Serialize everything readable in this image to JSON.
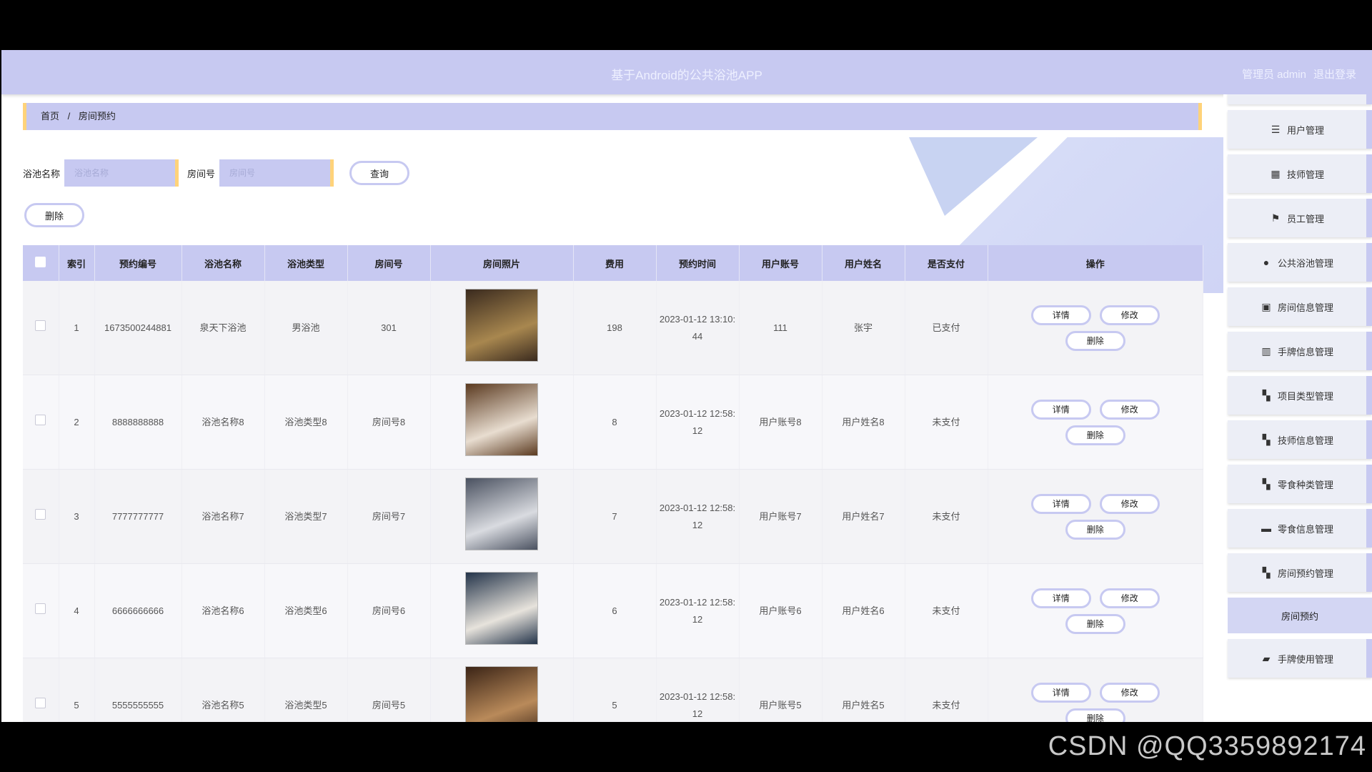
{
  "header": {
    "title": "基于Android的公共浴池APP",
    "role": "管理员 admin",
    "logout": "退出登录"
  },
  "breadcrumb": {
    "home": "首页",
    "separator": "/",
    "current": "房间预约"
  },
  "search": {
    "pool_label": "浴池名称",
    "pool_placeholder": "浴池名称",
    "room_label": "房间号",
    "room_placeholder": "房间号",
    "query_button": "查询"
  },
  "toolbar": {
    "delete_button": "删除"
  },
  "table": {
    "headers": [
      "索引",
      "预约编号",
      "浴池名称",
      "浴池类型",
      "房间号",
      "房间照片",
      "费用",
      "预约时间",
      "用户账号",
      "用户姓名",
      "是否支付",
      "操作"
    ],
    "rows": [
      {
        "index": "1",
        "code": "1673500244881",
        "pool": "泉天下浴池",
        "type": "男浴池",
        "room": "301",
        "fee": "198",
        "time": "2023-01-12 13:10:44",
        "account": "111",
        "name": "张宇",
        "paid": "已支付",
        "photo_colors": [
          "#3a2a1e",
          "#a8874f"
        ]
      },
      {
        "index": "2",
        "code": "8888888888",
        "pool": "浴池名称8",
        "type": "浴池类型8",
        "room": "房间号8",
        "fee": "8",
        "time": "2023-01-12 12:58:12",
        "account": "用户账号8",
        "name": "用户姓名8",
        "paid": "未支付",
        "photo_colors": [
          "#5b3a20",
          "#e8ddd0"
        ]
      },
      {
        "index": "3",
        "code": "7777777777",
        "pool": "浴池名称7",
        "type": "浴池类型7",
        "room": "房间号7",
        "fee": "7",
        "time": "2023-01-12 12:58:12",
        "account": "用户账号7",
        "name": "用户姓名7",
        "paid": "未支付",
        "photo_colors": [
          "#4a5160",
          "#d9dbe0"
        ]
      },
      {
        "index": "4",
        "code": "6666666666",
        "pool": "浴池名称6",
        "type": "浴池类型6",
        "room": "房间号6",
        "fee": "6",
        "time": "2023-01-12 12:58:12",
        "account": "用户账号6",
        "name": "用户姓名6",
        "paid": "未支付",
        "photo_colors": [
          "#24344a",
          "#e7e3dc"
        ]
      },
      {
        "index": "5",
        "code": "5555555555",
        "pool": "浴池名称5",
        "type": "浴池类型5",
        "room": "房间号5",
        "fee": "5",
        "time": "2023-01-12 12:58:12",
        "account": "用户账号5",
        "name": "用户姓名5",
        "paid": "未支付",
        "photo_colors": [
          "#3b2416",
          "#b98a5a"
        ]
      }
    ],
    "actions": {
      "detail": "详情",
      "edit": "修改",
      "delete": "删除"
    }
  },
  "sidebar": {
    "items": [
      {
        "label": "用户管理",
        "icon": "list-icon",
        "glyph": "☰"
      },
      {
        "label": "技师管理",
        "icon": "grid-icon",
        "glyph": "▦"
      },
      {
        "label": "员工管理",
        "icon": "flag-icon",
        "glyph": "⚑"
      },
      {
        "label": "公共浴池管理",
        "icon": "user-icon",
        "glyph": "●"
      },
      {
        "label": "房间信息管理",
        "icon": "clipboard-icon",
        "glyph": "▣"
      },
      {
        "label": "手牌信息管理",
        "icon": "book-icon",
        "glyph": "▥"
      },
      {
        "label": "项目类型管理",
        "icon": "apps-icon",
        "glyph": "▚"
      },
      {
        "label": "技师信息管理",
        "icon": "apps-icon",
        "glyph": "▚"
      },
      {
        "label": "零食种类管理",
        "icon": "apps-icon",
        "glyph": "▚"
      },
      {
        "label": "零食信息管理",
        "icon": "monitor-icon",
        "glyph": "▬"
      },
      {
        "label": "房间预约管理",
        "icon": "apps-icon",
        "glyph": "▚"
      }
    ],
    "sub_item": "房间预约",
    "last_item": {
      "label": "手牌使用管理",
      "icon": "chat-icon",
      "glyph": "▰"
    }
  },
  "watermark": "CSDN @QQ3359892174"
}
